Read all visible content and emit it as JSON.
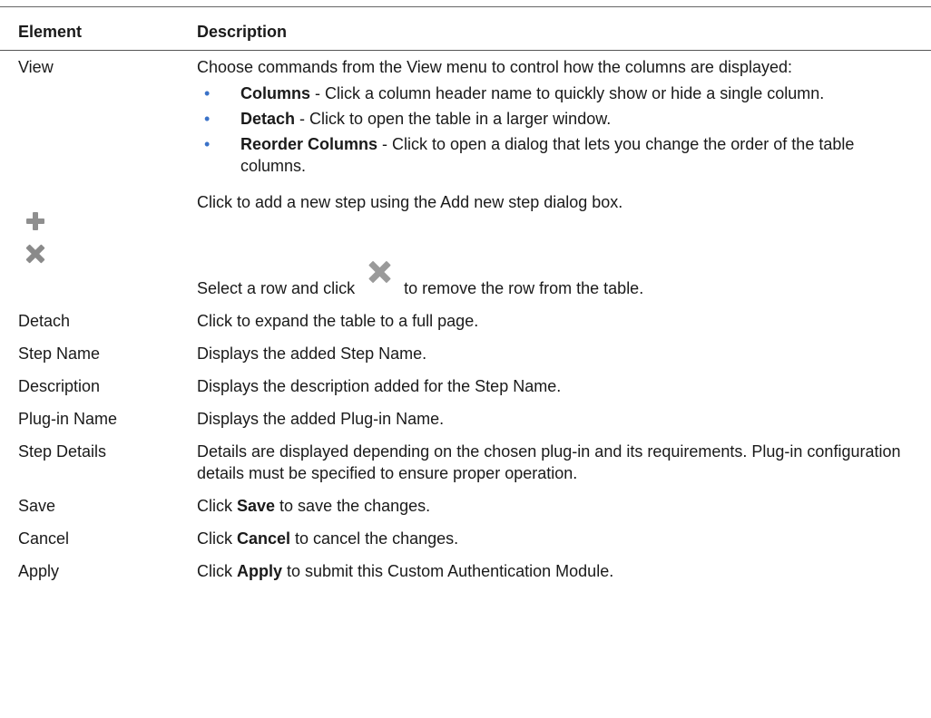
{
  "header": {
    "element": "Element",
    "description": "Description"
  },
  "rows": {
    "view": {
      "element": "View",
      "intro": "Choose commands from the View menu to control how the columns are displayed:",
      "bullets": [
        {
          "term": "Columns",
          "text": " - Click a column header name to quickly show or hide a single column."
        },
        {
          "term": "Detach",
          "text": " - Click to open the table in a larger window."
        },
        {
          "term": "Reorder Columns",
          "text": " - Click to open a dialog that lets you change the order of the table columns."
        }
      ]
    },
    "add": {
      "icon": "plus-icon",
      "description": "Click to add a new step using the Add new step dialog box."
    },
    "remove": {
      "icon": "close-icon",
      "before": "Select a row and click",
      "after": "to remove the row from the table."
    },
    "detach": {
      "element": "Detach",
      "description": "Click to expand the table to a full page."
    },
    "step_name": {
      "element": "Step Name",
      "description": "Displays the added Step Name."
    },
    "description": {
      "element": "Description",
      "description": "Displays the description added for the Step Name."
    },
    "plugin_name": {
      "element": "Plug-in Name",
      "description": "Displays the added Plug-in Name."
    },
    "step_details": {
      "element": "Step Details",
      "description": "Details are displayed depending on the chosen plug-in and its requirements. Plug-in configuration details must be specified to ensure proper operation."
    },
    "save": {
      "element": "Save",
      "pre": "Click ",
      "term": "Save",
      "post": " to save the changes."
    },
    "cancel": {
      "element": "Cancel",
      "pre": "Click ",
      "term": "Cancel",
      "post": " to cancel the changes."
    },
    "apply": {
      "element": "Apply",
      "pre": "Click ",
      "term": "Apply",
      "post": " to submit this Custom Authentication Module."
    }
  },
  "colors": {
    "bullet": "#3a72c8",
    "icon": "#8f8f8f"
  }
}
